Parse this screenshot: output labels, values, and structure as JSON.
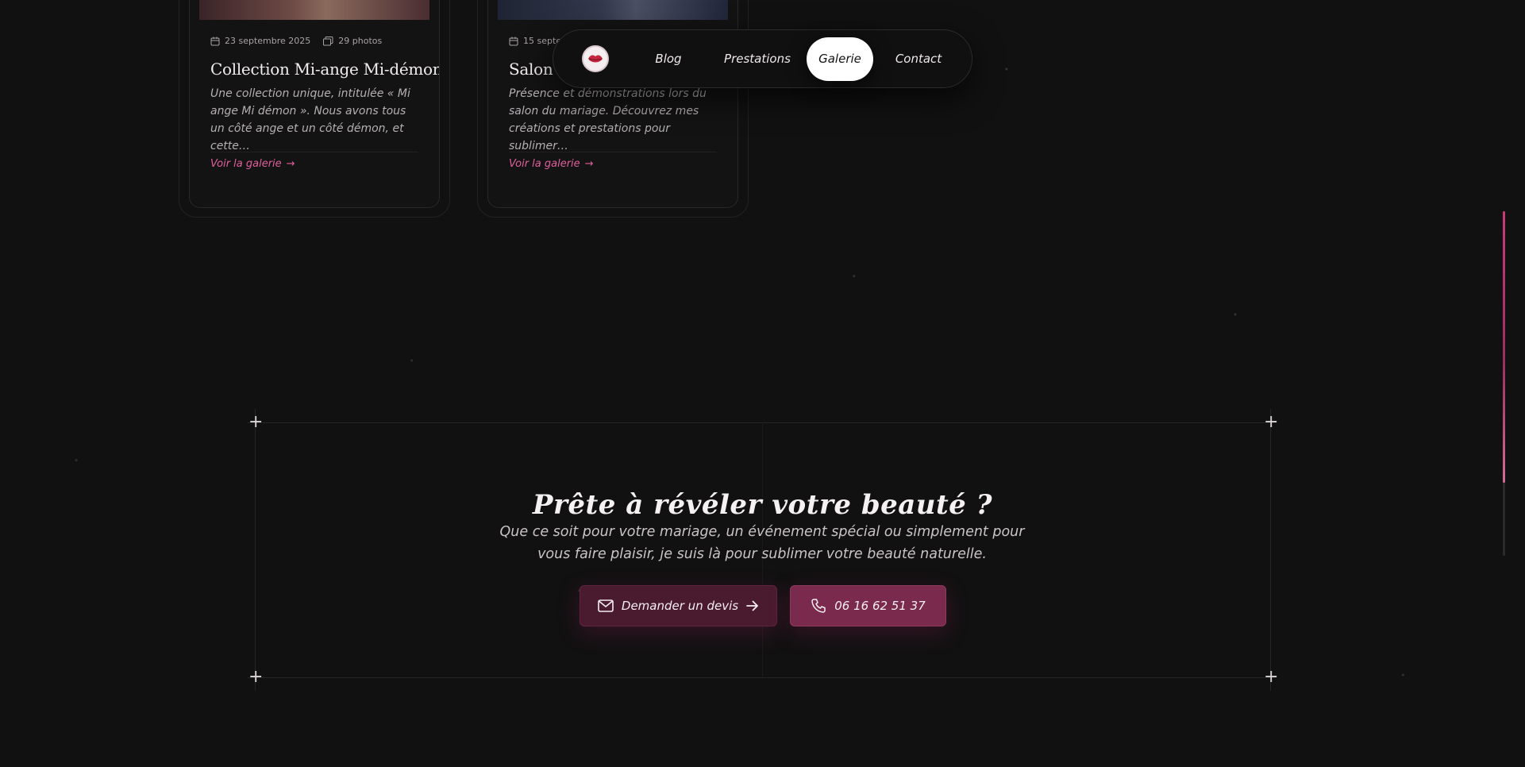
{
  "nav": {
    "items": [
      {
        "label": "Blog"
      },
      {
        "label": "Prestations"
      },
      {
        "label": "Galerie",
        "active": true
      },
      {
        "label": "Contact"
      }
    ],
    "logo_icon": "lips-logo-icon"
  },
  "gallery": {
    "cards": [
      {
        "date": "23 septembre 2025",
        "photos": "29 photos",
        "title": "Collection Mi-ange Mi-démon",
        "description": "Une collection unique, intitulée « Mi ange Mi démon ». Nous avons tous un côté ange et un côté démon, et cette…",
        "link": "Voir la galerie"
      },
      {
        "date": "15 septe",
        "title": "Salon du",
        "description": "Présence et démonstrations lors du salon du mariage. Découvrez mes créations et prestations pour sublimer…",
        "link": "Voir la galerie"
      }
    ]
  },
  "cta": {
    "title": "Prête à révéler votre beauté ?",
    "text": "Que ce soit pour votre mariage, un événement spécial ou simplement pour vous faire plaisir, je suis là pour sublimer votre beauté naturelle.",
    "quote_button": "Demander un devis",
    "phone_button": "06 16 62 51 37"
  },
  "colors": {
    "background": "#121112",
    "accent_pink": "#e0609c",
    "button_quote": "#4a1b2f",
    "button_phone": "#7a2a4c"
  }
}
